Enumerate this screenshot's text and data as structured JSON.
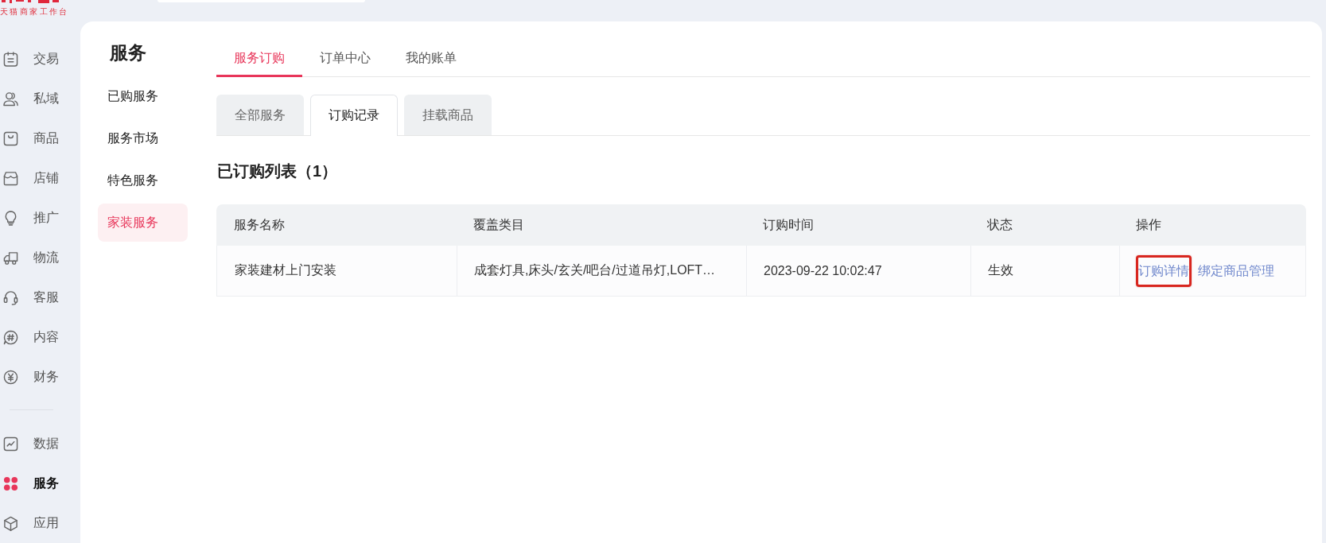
{
  "brand": {
    "subtitle": "天猫商家工作台"
  },
  "nav": {
    "sections": [
      {
        "items": [
          {
            "label": "交易",
            "selected": false
          },
          {
            "label": "私域",
            "selected": false
          },
          {
            "label": "商品",
            "selected": false
          },
          {
            "label": "店铺",
            "selected": false
          },
          {
            "label": "推广",
            "selected": false
          },
          {
            "label": "物流",
            "selected": false
          },
          {
            "label": "客服",
            "selected": false
          },
          {
            "label": "内容",
            "selected": false
          },
          {
            "label": "财务",
            "selected": false
          }
        ]
      },
      {
        "items": [
          {
            "label": "数据",
            "selected": false
          },
          {
            "label": "服务",
            "selected": true
          },
          {
            "label": "应用",
            "selected": false
          }
        ]
      }
    ]
  },
  "side_menu": {
    "title": "服务",
    "items": [
      {
        "label": "已购服务",
        "selected": false
      },
      {
        "label": "服务市场",
        "selected": false
      },
      {
        "label": "特色服务",
        "selected": false
      },
      {
        "label": "家装服务",
        "selected": true
      }
    ]
  },
  "tabs": [
    {
      "label": "服务订购",
      "selected": true
    },
    {
      "label": "订单中心",
      "selected": false
    },
    {
      "label": "我的账单",
      "selected": false
    }
  ],
  "sub_tabs": [
    {
      "label": "全部服务",
      "selected": false
    },
    {
      "label": "订购记录",
      "selected": true
    },
    {
      "label": "挂载商品",
      "selected": false
    }
  ],
  "list": {
    "title": "已订购列表（1）",
    "table": {
      "columns": [
        "服务名称",
        "覆盖类目",
        "订购时间",
        "状态",
        "操作"
      ],
      "rows": [
        {
          "cells": [
            "家装建材上门安装",
            "成套灯具,床头/玄关/吧台/过道吊灯,LOFT…",
            "2023-09-22 10:02:47",
            "生效"
          ],
          "actions": [
            {
              "label": "订购详情",
              "highlighted": true
            },
            {
              "label": "绑定商品管理",
              "highlighted": false
            }
          ]
        }
      ]
    }
  }
}
